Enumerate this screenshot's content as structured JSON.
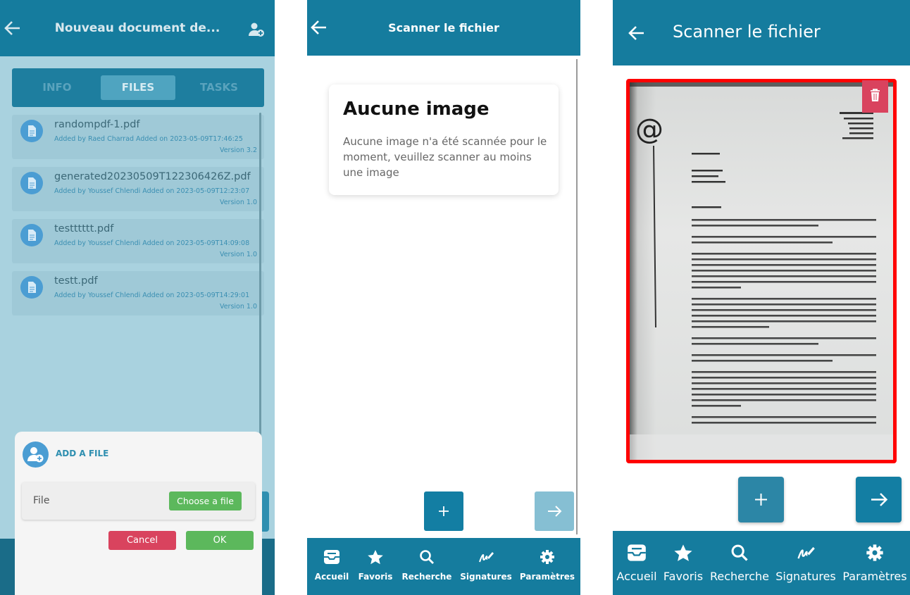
{
  "panel1": {
    "appbar": {
      "title": "Nouveau document de..."
    },
    "tabs": [
      {
        "label": "INFO",
        "active": false
      },
      {
        "label": "FILES",
        "active": true
      },
      {
        "label": "TASKS",
        "active": false
      }
    ],
    "files": [
      {
        "name": "randompdf-1.pdf",
        "meta": "Added by Raed Charrad Added on 2023-05-09T17:46:25",
        "version": "Version 3.2"
      },
      {
        "name": "generated20230509T122306426Z.pdf",
        "meta": "Added by Youssef Chlendi Added on 2023-05-09T12:23:07",
        "version": "Version 1.0"
      },
      {
        "name": "testttttt.pdf",
        "meta": "Added by Youssef Chlendi Added on 2023-05-09T14:09:08",
        "version": "Version 1.0"
      },
      {
        "name": "testt.pdf",
        "meta": "Added by Youssef Chlendi Added on 2023-05-09T14:29:01",
        "version": "Version 1.0"
      }
    ],
    "dialog": {
      "title": "ADD A FILE",
      "field_label": "File",
      "choose_label": "Choose a file",
      "cancel_label": "Cancel",
      "ok_label": "OK"
    }
  },
  "panel2": {
    "appbar": {
      "title": "Scanner le fichier"
    },
    "card": {
      "heading": "Aucune image",
      "text": "Aucune image n'a été scannée pour le moment, veuillez scanner au moins une image"
    },
    "add_label": "+",
    "next_label": "→"
  },
  "panel3": {
    "appbar": {
      "title": "Scanner le fichier"
    },
    "add_label": "+",
    "next_label": "→"
  },
  "tabbar": {
    "items": [
      {
        "label": "Accueil",
        "icon": "inbox-icon"
      },
      {
        "label": "Favoris",
        "icon": "star-icon"
      },
      {
        "label": "Recherche",
        "icon": "search-icon"
      },
      {
        "label": "Signatures",
        "icon": "signature-icon"
      },
      {
        "label": "Paramètres",
        "icon": "gear-icon"
      }
    ]
  },
  "colors": {
    "primary": "#157c9e",
    "danger": "#d9435e",
    "success": "#5cb85c",
    "highlight": "#ff0000"
  }
}
